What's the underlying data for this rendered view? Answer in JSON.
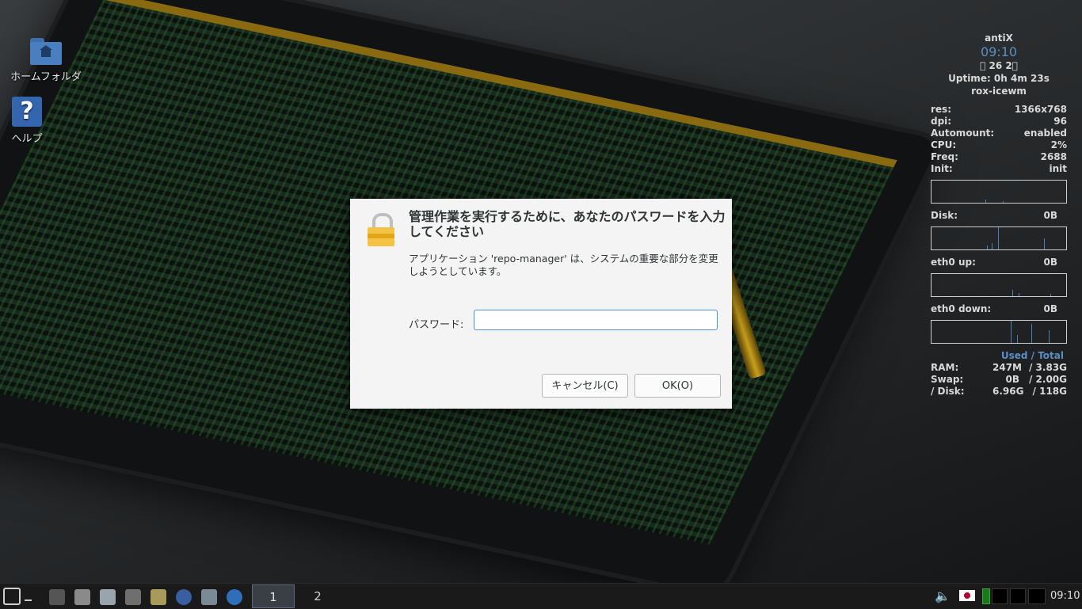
{
  "desktop": {
    "icons": [
      {
        "label": "ホームフォルダ",
        "icon": "home-folder-icon"
      },
      {
        "label": "ヘルプ",
        "icon": "help-icon"
      }
    ]
  },
  "conky": {
    "hostname": "antiX",
    "time": "09:10",
    "date": "\u0000 26  2\u0000",
    "uptime": "Uptime: 0h 4m 23s",
    "session": "rox-icewm",
    "stats": [
      {
        "key": "res:",
        "value": "1366x768"
      },
      {
        "key": "dpi:",
        "value": "96"
      },
      {
        "key": "Automount:",
        "value": "enabled"
      },
      {
        "key": "CPU:",
        "value": "2%"
      },
      {
        "key": "Freq:",
        "value": "2688"
      },
      {
        "key": "Init:",
        "value": "init"
      }
    ],
    "disk": {
      "label": "Disk:",
      "value": "0B"
    },
    "eth_up": {
      "label": "eth0 up:",
      "value": "0B"
    },
    "eth_down": {
      "label": "eth0 down:",
      "value": "0B"
    },
    "used_total": "Used / Total",
    "mem": [
      {
        "key": "RAM:",
        "used": "247M",
        "total": "/ 3.83G"
      },
      {
        "key": "Swap:",
        "used": "0B",
        "total": "/ 2.00G"
      },
      {
        "key": "/ Disk:",
        "used": "6.96G",
        "total": "/ 118G"
      }
    ]
  },
  "dialog": {
    "title": "管理作業を実行するために、あなたのパスワードを入力してください",
    "message": "アプリケーション 'repo-manager' は、システムの重要な部分を変更しようとしています。",
    "password_label": "パスワード:",
    "password_value": "",
    "cancel_label": "キャンセル(C)",
    "ok_label": "OK(O)"
  },
  "taskbar": {
    "workspaces": [
      "1",
      "2"
    ],
    "active_workspace": "1",
    "clock": "09:10",
    "launchers": [
      "show-desktop-icon",
      "installer-icon",
      "file-manager-icon",
      "eject-icon",
      "package-icon",
      "browser-icon",
      "network-icon",
      "updater-icon"
    ],
    "colors": {
      "accent": "#5b8fc4",
      "panel": "#1a1a1a"
    }
  }
}
